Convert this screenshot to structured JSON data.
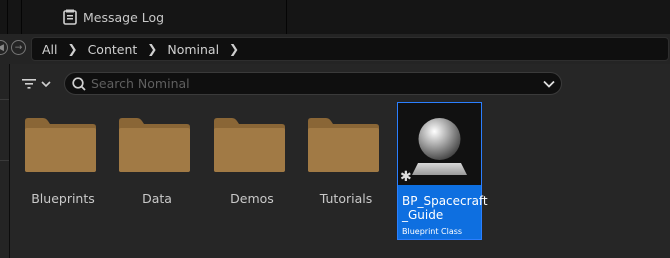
{
  "tab": {
    "label": "Message Log",
    "icon": "message-log-icon"
  },
  "breadcrumb": {
    "items": [
      "All",
      "Content",
      "Nominal"
    ]
  },
  "search": {
    "placeholder": "Search Nominal"
  },
  "folders": [
    {
      "label": "Blueprints"
    },
    {
      "label": "Data"
    },
    {
      "label": "Demos"
    },
    {
      "label": "Tutorials"
    }
  ],
  "asset": {
    "name_line1": "BP_Spacecraft",
    "name_line2": "_Guide",
    "type": "Blueprint Class"
  },
  "colors": {
    "selection": "#0e6fe0",
    "folder": "#a17a45",
    "background": "#262626"
  }
}
